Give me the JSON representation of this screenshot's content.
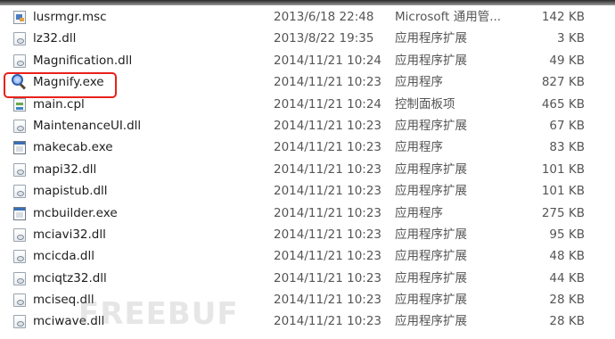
{
  "files": [
    {
      "name": "lusrmgr.msc",
      "date": "2013/6/18 22:48",
      "type": "Microsoft 通用管...",
      "size": "142 KB",
      "icon": "msc-file-icon"
    },
    {
      "name": "lz32.dll",
      "date": "2013/8/22 19:35",
      "type": "应用程序扩展",
      "size": "3 KB",
      "icon": "dll-file-icon"
    },
    {
      "name": "Magnification.dll",
      "date": "2014/11/21 10:24",
      "type": "应用程序扩展",
      "size": "49 KB",
      "icon": "dll-file-icon"
    },
    {
      "name": "Magnify.exe",
      "date": "2014/11/21 10:23",
      "type": "应用程序",
      "size": "827 KB",
      "icon": "magnifier-app-icon"
    },
    {
      "name": "main.cpl",
      "date": "2014/11/21 10:24",
      "type": "控制面板项",
      "size": "465 KB",
      "icon": "control-panel-file-icon"
    },
    {
      "name": "MaintenanceUI.dll",
      "date": "2014/11/21 10:23",
      "type": "应用程序扩展",
      "size": "67 KB",
      "icon": "dll-file-icon"
    },
    {
      "name": "makecab.exe",
      "date": "2014/11/21 10:23",
      "type": "应用程序",
      "size": "83 KB",
      "icon": "exe-file-icon"
    },
    {
      "name": "mapi32.dll",
      "date": "2014/11/21 10:23",
      "type": "应用程序扩展",
      "size": "101 KB",
      "icon": "dll-file-icon"
    },
    {
      "name": "mapistub.dll",
      "date": "2014/11/21 10:23",
      "type": "应用程序扩展",
      "size": "101 KB",
      "icon": "dll-file-icon"
    },
    {
      "name": "mcbuilder.exe",
      "date": "2014/11/21 10:23",
      "type": "应用程序",
      "size": "275 KB",
      "icon": "exe-file-icon"
    },
    {
      "name": "mciavi32.dll",
      "date": "2014/11/21 10:23",
      "type": "应用程序扩展",
      "size": "95 KB",
      "icon": "dll-file-icon"
    },
    {
      "name": "mcicda.dll",
      "date": "2014/11/21 10:23",
      "type": "应用程序扩展",
      "size": "48 KB",
      "icon": "dll-file-icon"
    },
    {
      "name": "mciqtz32.dll",
      "date": "2014/11/21 10:23",
      "type": "应用程序扩展",
      "size": "44 KB",
      "icon": "dll-file-icon"
    },
    {
      "name": "mciseq.dll",
      "date": "2014/11/21 10:23",
      "type": "应用程序扩展",
      "size": "28 KB",
      "icon": "dll-file-icon"
    },
    {
      "name": "mciwave.dll",
      "date": "2014/11/21 10:23",
      "type": "应用程序扩展",
      "size": "28 KB",
      "icon": "dll-file-icon"
    }
  ],
  "highlighted_file": "Magnify.exe",
  "highlight_color": "#e8211b",
  "watermark": "FREEBUF"
}
